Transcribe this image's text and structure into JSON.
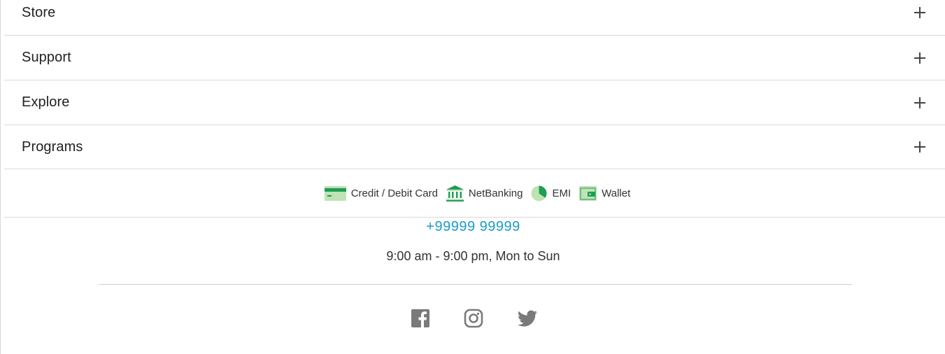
{
  "accordion": [
    {
      "label": "Store"
    },
    {
      "label": "Support"
    },
    {
      "label": "Explore"
    },
    {
      "label": "Programs"
    }
  ],
  "payments": [
    {
      "label": "Credit / Debit Card",
      "icon": "credit-card-icon"
    },
    {
      "label": "NetBanking",
      "icon": "bank-icon"
    },
    {
      "label": "EMI",
      "icon": "pie-chart-icon"
    },
    {
      "label": "Wallet",
      "icon": "wallet-icon"
    }
  ],
  "contact": {
    "phone": "+99999 99999",
    "hours": "9:00 am - 9:00 pm, Mon to Sun"
  },
  "social": [
    {
      "name": "facebook-icon"
    },
    {
      "name": "instagram-icon"
    },
    {
      "name": "twitter-icon"
    }
  ],
  "colors": {
    "accent": "#1a9bc7",
    "icon_green": "#1f9d55",
    "icon_light_green": "#bfe3b4",
    "social_gray": "#7a7a7a"
  }
}
